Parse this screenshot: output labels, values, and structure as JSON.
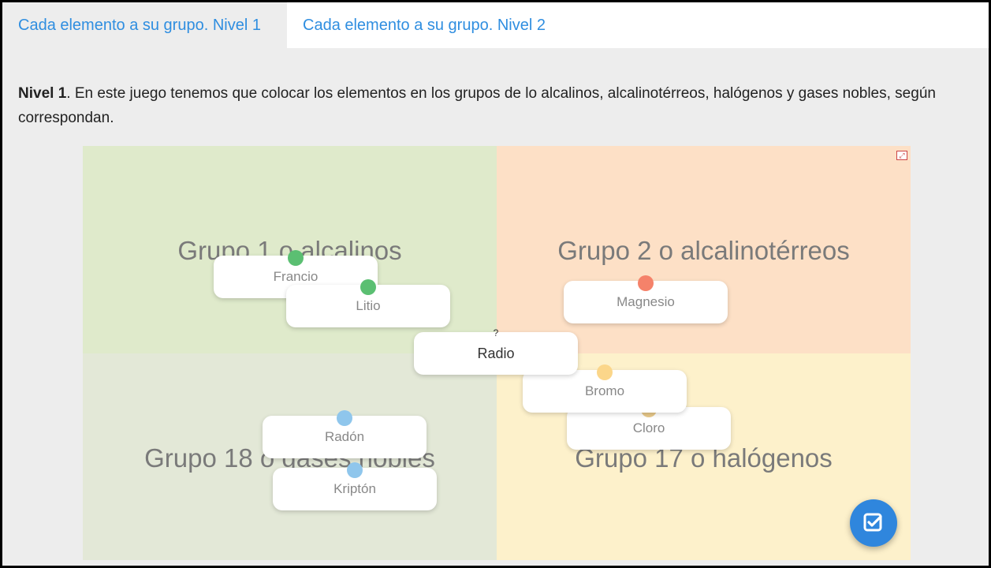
{
  "tabs": [
    {
      "label": "Cada elemento a su grupo. Nivel 1",
      "active": true
    },
    {
      "label": "Cada elemento a su grupo. Nivel 2",
      "active": false
    }
  ],
  "intro": {
    "bold": "Nivel 1",
    "text": ". En este juego tenemos que colocar los elementos en los grupos de lo alcalinos, alcalinotérreos, halógenos y gases nobles, según correspondan."
  },
  "zones": [
    {
      "title": "Grupo 1 o alcalinos",
      "color": "#dfeacb"
    },
    {
      "title": "Grupo 2 o alcalinotérreos",
      "color": "#fde0c6"
    },
    {
      "title": "Grupo 18 o gases nobles",
      "color": "#e3e8d7"
    },
    {
      "title": "Grupo 17 o halógenos",
      "color": "#fdf1cb"
    }
  ],
  "cards": {
    "francio": {
      "label": "Francio",
      "dot": "#5bbf72"
    },
    "litio": {
      "label": "Litio",
      "dot": "#5bbf72"
    },
    "magnesio": {
      "label": "Magnesio",
      "dot": "#f5826a"
    },
    "radio": {
      "label": "Radio",
      "marker": "?"
    },
    "bromo": {
      "label": "Bromo",
      "dot": "#fbd68a"
    },
    "cloro": {
      "label": "Cloro",
      "dot": "#e8c98a"
    },
    "radon": {
      "label": "Radón",
      "dot": "#8fc6ec"
    },
    "kripton": {
      "label": "Kriptón",
      "dot": "#8fc6ec"
    }
  },
  "icons": {
    "expand": "expand-icon",
    "check": "check-icon"
  }
}
